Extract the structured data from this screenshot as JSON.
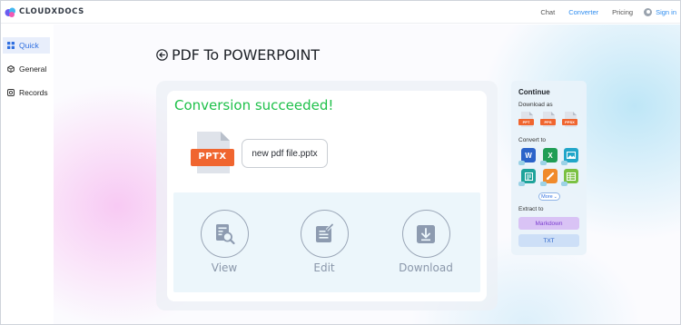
{
  "app": {
    "logo_text": "CLOUDXDOCS"
  },
  "nav": {
    "chat": "Chat",
    "converter": "Converter",
    "pricing": "Pricing",
    "signin": "Sign in"
  },
  "sidebar": {
    "items": [
      {
        "label": "Quick",
        "icon": "grid-icon",
        "active": true
      },
      {
        "label": "General",
        "icon": "cube-icon",
        "active": false
      },
      {
        "label": "Records",
        "icon": "records-icon",
        "active": false
      }
    ]
  },
  "page": {
    "title": "PDF To POWERPOINT",
    "status": "Conversion succeeded!",
    "file_type": "PPTX",
    "file_name": "new pdf file.pptx",
    "actions": {
      "view": "View",
      "edit": "Edit",
      "download": "Download"
    }
  },
  "panel": {
    "title": "Continue",
    "download_as": "Download as",
    "download_formats": [
      "PPT",
      "PPS",
      "PPSX"
    ],
    "convert_to": "Convert to",
    "convert_icons": [
      "word-icon",
      "excel-icon",
      "image-icon",
      "html-icon",
      "pdf-edit-icon",
      "table-icon"
    ],
    "more": "More",
    "extract_to": "Extract to",
    "extract_markdown": "Markdown",
    "extract_txt": "TXT"
  },
  "colors": {
    "accent": "#2f8df0",
    "success": "#1fc14a",
    "pptx_badge": "#f0652f"
  }
}
